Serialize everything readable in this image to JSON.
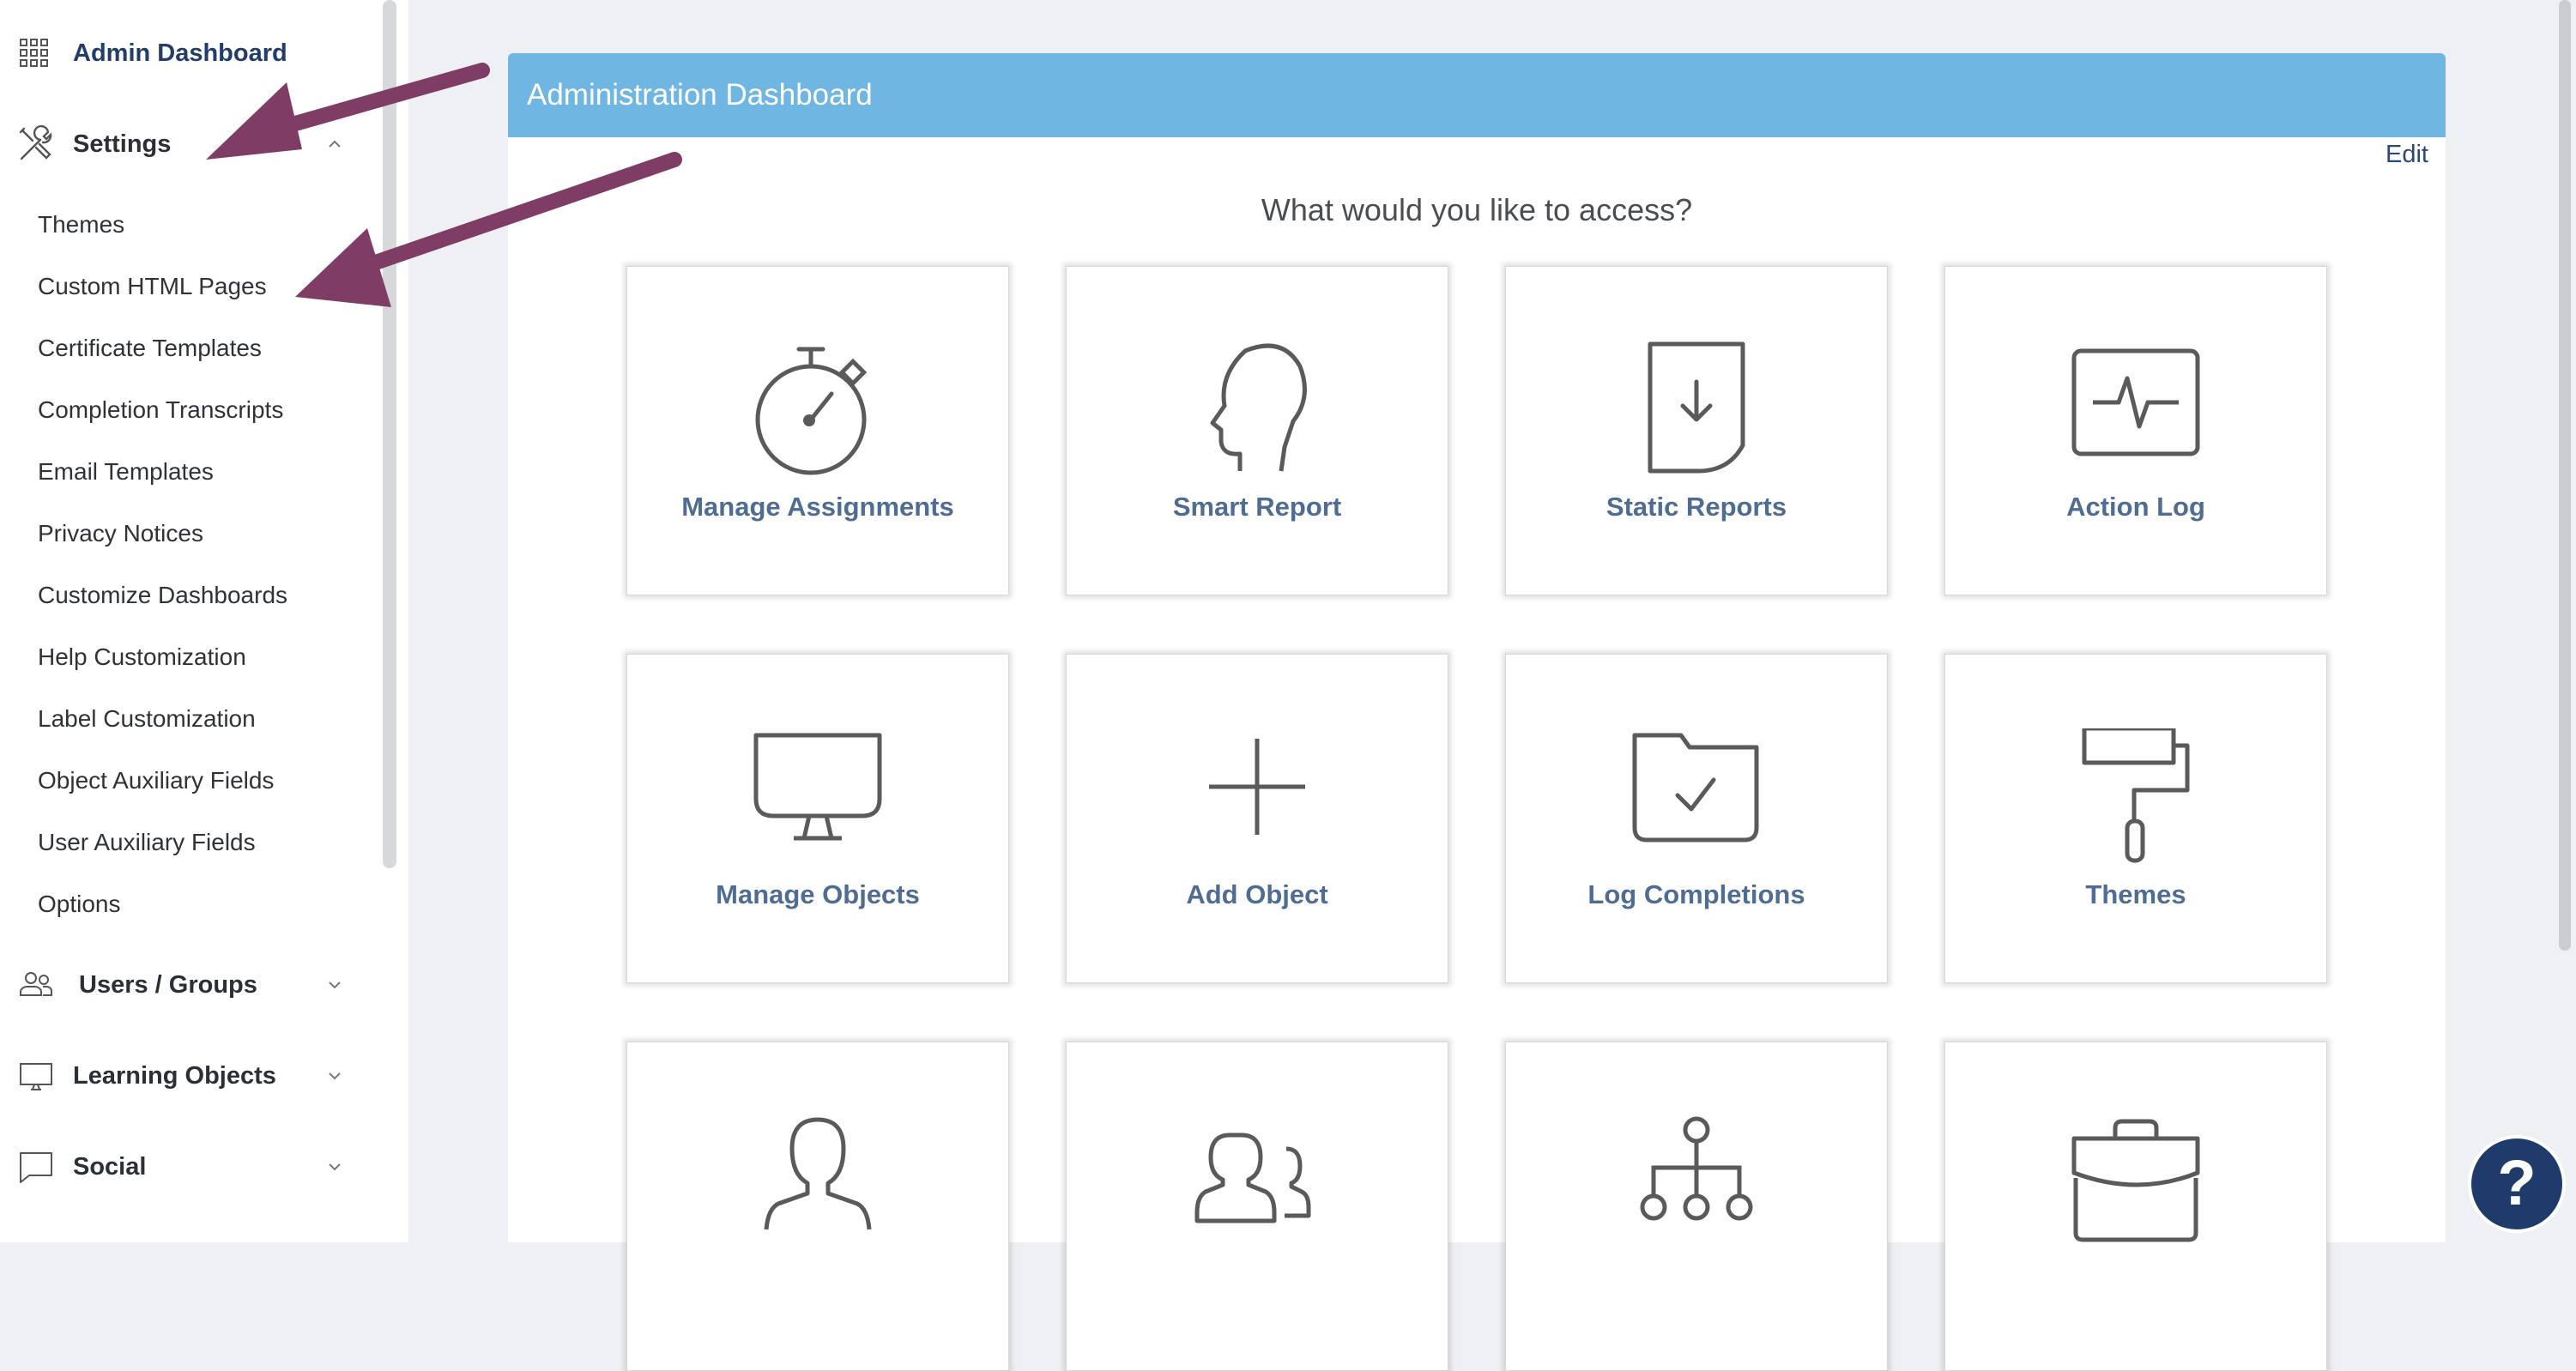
{
  "sidebar": {
    "top": {
      "label": "Admin Dashboard",
      "icon": "grid-icon"
    },
    "settings": {
      "label": "Settings",
      "icon": "tools-icon",
      "expanded": true,
      "items": [
        "Themes",
        "Custom HTML Pages",
        "Certificate Templates",
        "Completion Transcripts",
        "Email Templates",
        "Privacy Notices",
        "Customize Dashboards",
        "Help Customization",
        "Label Customization",
        "Object Auxiliary Fields",
        "User Auxiliary Fields",
        "Options"
      ]
    },
    "users_groups": {
      "label": "Users / Groups",
      "icon": "users-icon"
    },
    "learning_objects": {
      "label": "Learning Objects",
      "icon": "monitor-icon"
    },
    "social": {
      "label": "Social",
      "icon": "chat-icon"
    }
  },
  "panel": {
    "title": "Administration Dashboard",
    "edit_label": "Edit",
    "prompt": "What would you like to access?",
    "tiles": [
      {
        "label": "Manage Assignments",
        "icon": "stopwatch-icon"
      },
      {
        "label": "Smart Report",
        "icon": "head-icon"
      },
      {
        "label": "Static Reports",
        "icon": "document-download-icon"
      },
      {
        "label": "Action Log",
        "icon": "activity-monitor-icon"
      },
      {
        "label": "Manage Objects",
        "icon": "monitor-icon"
      },
      {
        "label": "Add Object",
        "icon": "plus-icon"
      },
      {
        "label": "Log Completions",
        "icon": "folder-check-icon"
      },
      {
        "label": "Themes",
        "icon": "paint-roller-icon"
      },
      {
        "label": "",
        "icon": "user-icon"
      },
      {
        "label": "",
        "icon": "users-icon"
      },
      {
        "label": "",
        "icon": "hierarchy-icon"
      },
      {
        "label": "",
        "icon": "briefcase-icon"
      }
    ]
  },
  "help": {
    "label": "?",
    "icon": "help-icon"
  },
  "colors": {
    "header": "#6fb6e3",
    "tile_label": "#4f6d94",
    "arrow": "#7f3d66",
    "help": "#1e3b6b"
  }
}
